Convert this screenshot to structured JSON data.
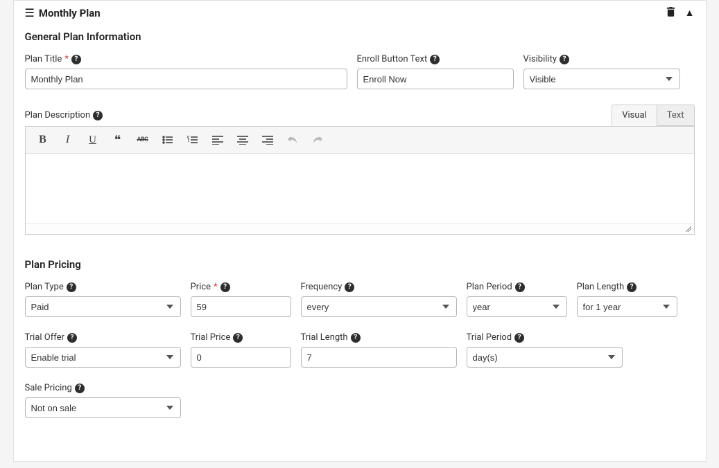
{
  "card": {
    "title": "Monthly Plan"
  },
  "general": {
    "section_title": "General Plan Information",
    "plan_title_label": "Plan Title",
    "plan_title_value": "Monthly Plan",
    "enroll_label": "Enroll Button Text",
    "enroll_value": "Enroll Now",
    "visibility_label": "Visibility",
    "visibility_value": "Visible",
    "desc_label": "Plan Description",
    "tab_visual": "Visual",
    "tab_text": "Text",
    "strike_label": "ABC"
  },
  "pricing": {
    "section_title": "Plan Pricing",
    "plan_type_label": "Plan Type",
    "plan_type_value": "Paid",
    "price_label": "Price",
    "price_value": "59",
    "frequency_label": "Frequency",
    "frequency_value": "every",
    "plan_period_label": "Plan Period",
    "plan_period_value": "year",
    "plan_length_label": "Plan Length",
    "plan_length_value": "for 1 year",
    "trial_offer_label": "Trial Offer",
    "trial_offer_value": "Enable trial",
    "trial_price_label": "Trial Price",
    "trial_price_value": "0",
    "trial_length_label": "Trial Length",
    "trial_length_value": "7",
    "trial_period_label": "Trial Period",
    "trial_period_value": "day(s)",
    "sale_label": "Sale Pricing",
    "sale_value": "Not on sale"
  }
}
